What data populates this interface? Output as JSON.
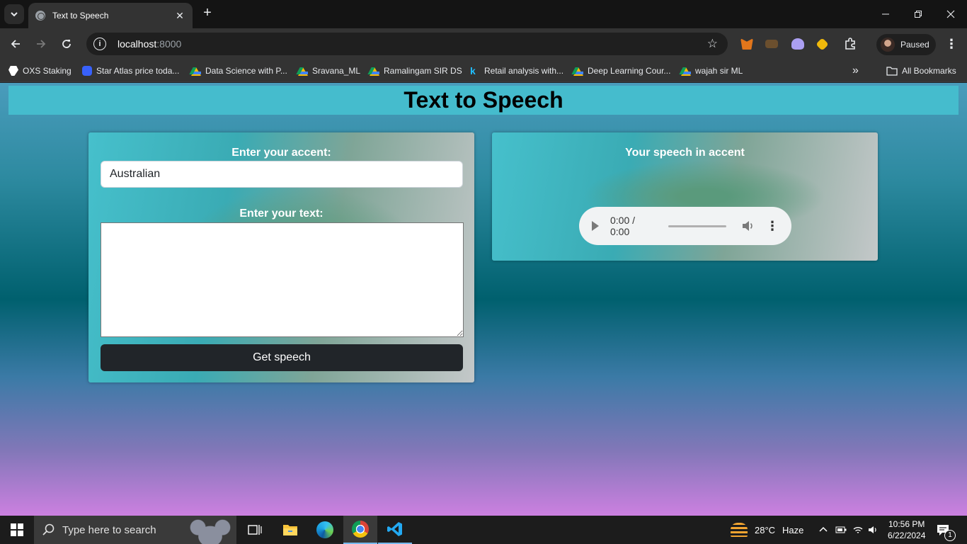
{
  "browser": {
    "tab_title": "Text to Speech",
    "new_tab_symbol": "+",
    "close_symbol": "✕",
    "address_host": "localhost",
    "address_port": ":8000",
    "profile_status": "Paused"
  },
  "bookmarks": [
    {
      "label": "OXS Staking",
      "icon": "oxs-icon"
    },
    {
      "label": "Star Atlas price toda...",
      "icon": "coinmarketcap-icon"
    },
    {
      "label": "Data Science with P...",
      "icon": "drive-icon"
    },
    {
      "label": "Sravana_ML",
      "icon": "drive-icon"
    },
    {
      "label": "Ramalingam SIR DS",
      "icon": "drive-icon"
    },
    {
      "label": "Retail analysis with...",
      "icon": "kaggle-icon"
    },
    {
      "label": "Deep Learning Cour...",
      "icon": "drive-icon"
    },
    {
      "label": "wajah sir ML",
      "icon": "drive-icon"
    }
  ],
  "bookmarks_overflow": "»",
  "all_bookmarks_label": "All Bookmarks",
  "page": {
    "heading": "Text to Speech",
    "accent_label": "Enter your accent:",
    "accent_value": "Australian",
    "text_label": "Enter your text:",
    "text_value": "",
    "submit_label": "Get speech",
    "output_label": "Your speech in accent",
    "audio_time": "0:00 / 0:00"
  },
  "taskbar": {
    "search_placeholder": "Type here to search",
    "weather_temp": "28°C",
    "weather_desc": "Haze",
    "time": "10:56 PM",
    "date": "6/22/2024",
    "notification_count": "1"
  },
  "colors": {
    "banner": "#45bccd",
    "button": "#212529",
    "accent_blue": "#76b9ed"
  }
}
